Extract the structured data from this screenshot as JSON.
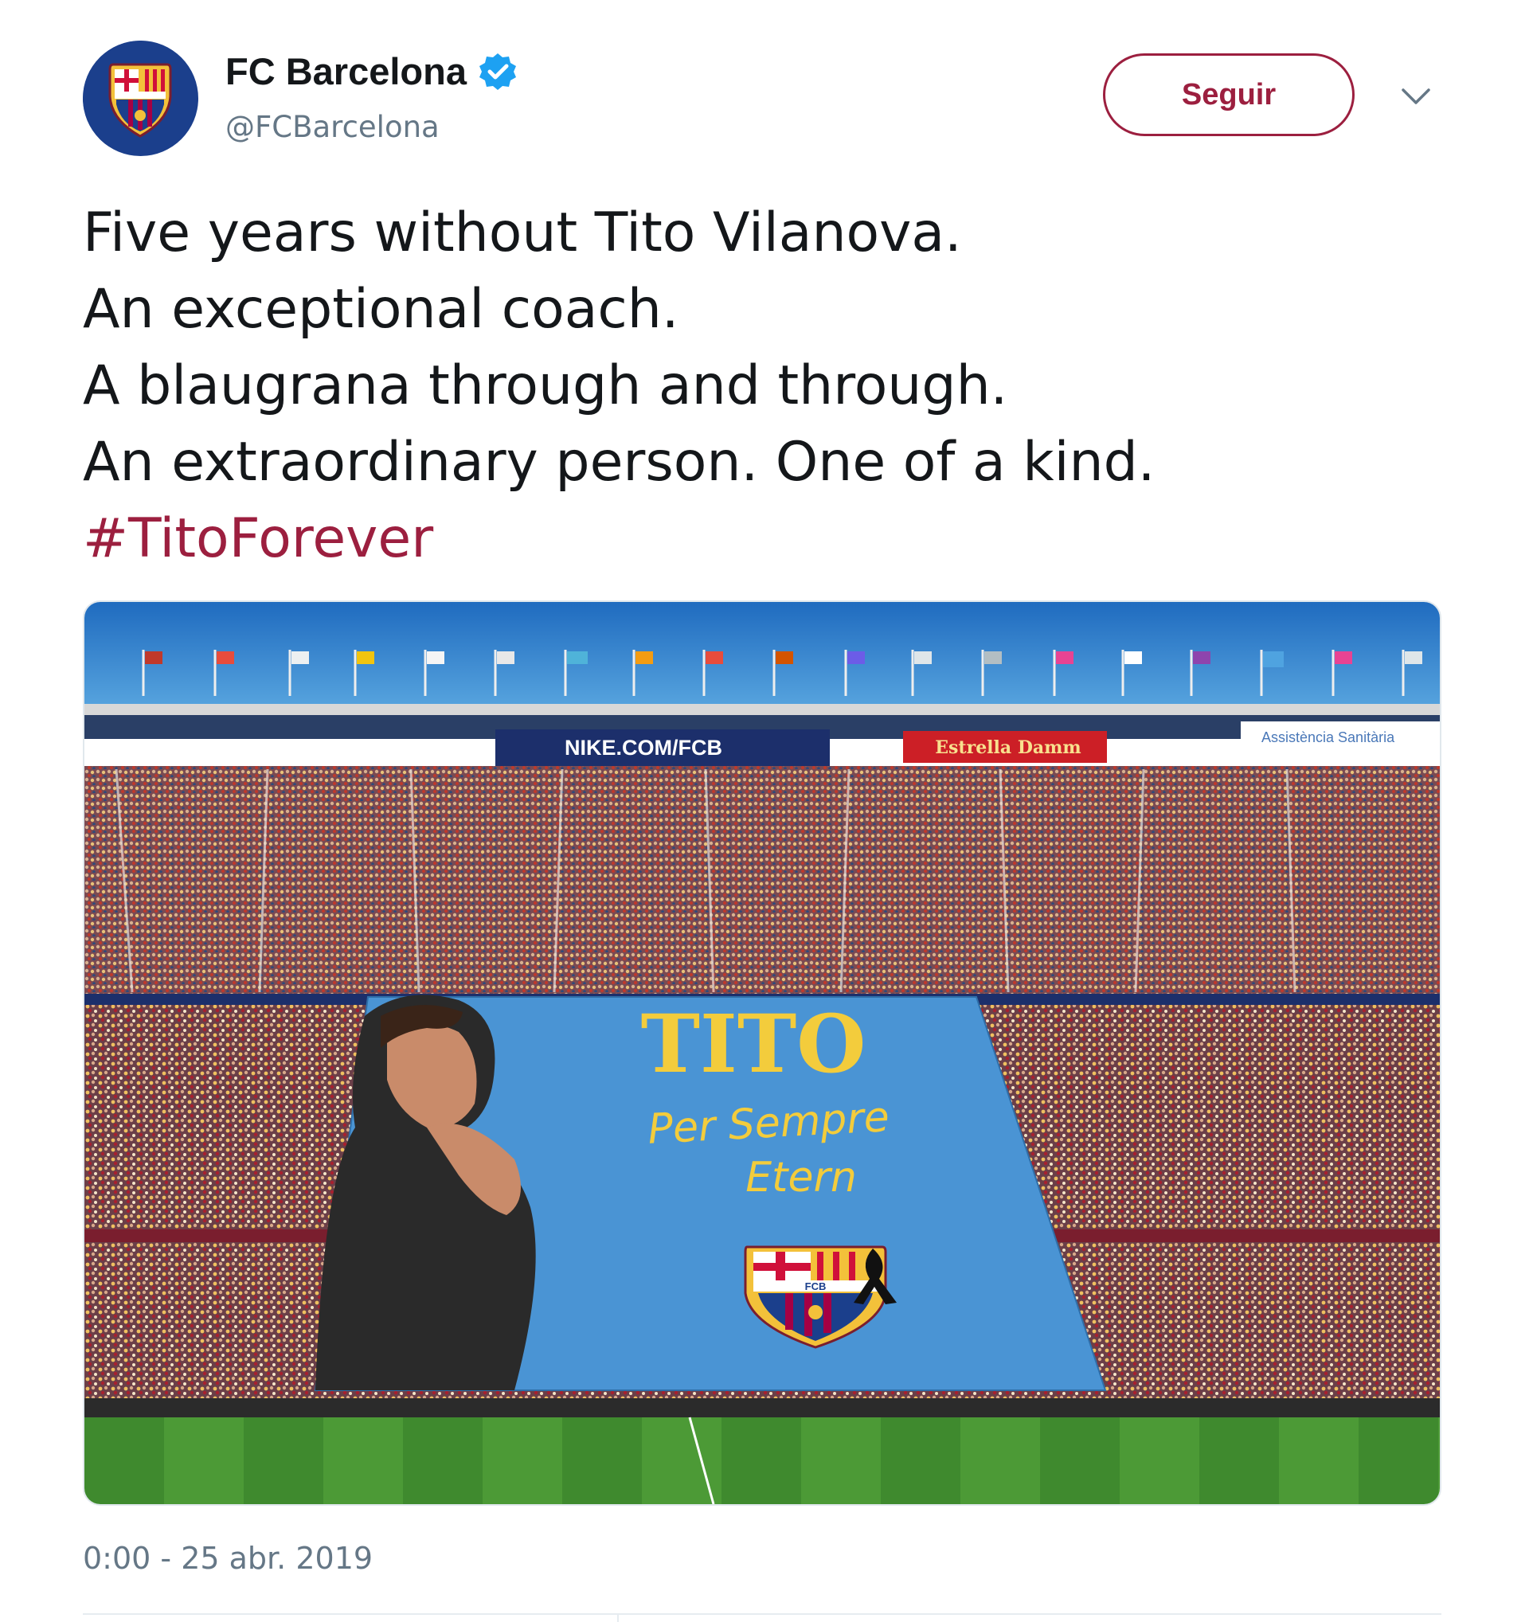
{
  "account": {
    "name": "FC Barcelona",
    "handle": "@FCBarcelona",
    "verified_icon": "verified-badge-icon",
    "avatar": "fcb-crest-avatar"
  },
  "actions": {
    "follow_label": "Seguir",
    "menu_icon": "chevron-down-icon"
  },
  "tweet": {
    "lines": [
      "Five years without Tito Vilanova.",
      "An exceptional coach.",
      "A blaugrana through and through.",
      "An extraordinary person. One of a kind."
    ],
    "hashtag": "#TitoForever",
    "timestamp": "0:00 - 25 abr. 2019"
  },
  "media": {
    "ad_nike": "NIKE.COM/FCB",
    "ad_estrella": "Estrella Damm",
    "ad_assistencia": "Assistència Sanitària",
    "banner_title": "TITO",
    "banner_line1": "Per Sempre",
    "banner_line2": "Etern",
    "crest_label": "FCB"
  },
  "colors": {
    "brand": "#9c1f3f",
    "text": "#14171a",
    "muted": "#657786",
    "verified": "#1da1f2",
    "banner": "#4a94d4",
    "banner_text": "#f3cc3c"
  }
}
